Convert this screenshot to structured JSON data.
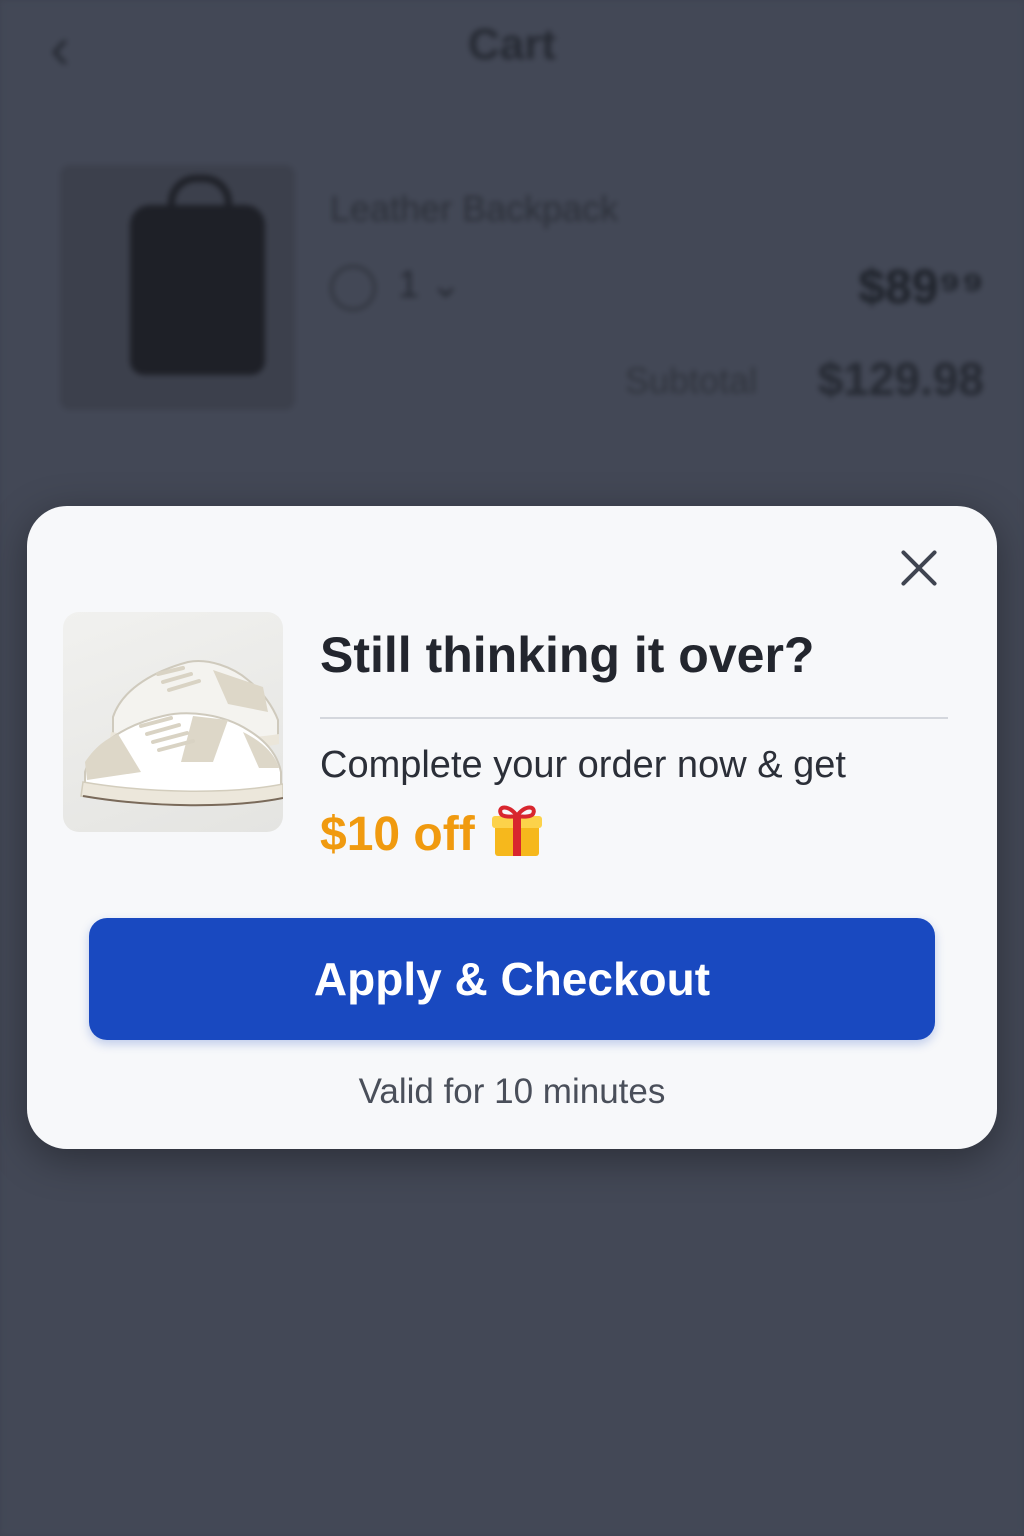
{
  "background": {
    "header": {
      "back_icon": "chevron-left-icon",
      "title": "Cart"
    },
    "cart_item": {
      "name": "Leather Backpack",
      "quantity": "1 ⌄",
      "price": "$89⁹⁹"
    },
    "subtotal": {
      "label": "Subtotal",
      "value": "$129.98"
    }
  },
  "modal": {
    "close_icon": "close-icon",
    "product_image": "sneakers-image",
    "headline": "Still thinking it over?",
    "body": "Complete your order now & get",
    "discount": "$10 off",
    "discount_icon": "gift-icon",
    "cta_label": "Apply & Checkout",
    "validity": "Valid for 10 minutes"
  },
  "colors": {
    "accent_button": "#1949c0",
    "discount_text": "#f09a0f",
    "overlay": "#434856",
    "modal_bg": "#f7f8fa"
  }
}
